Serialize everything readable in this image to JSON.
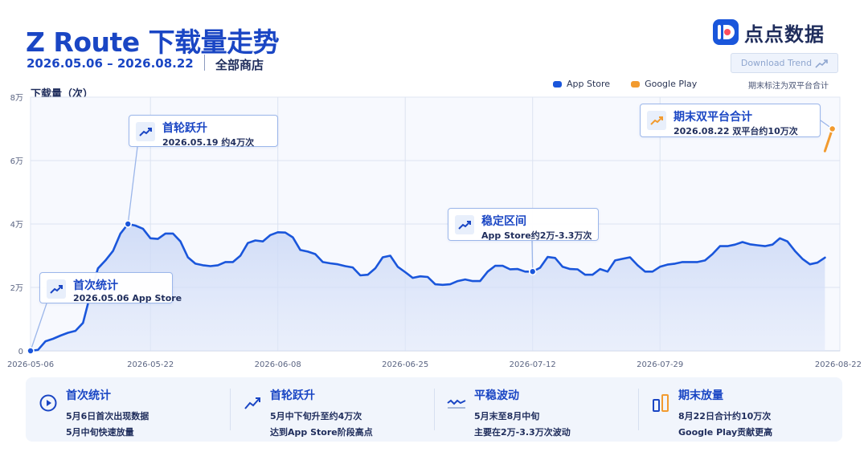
{
  "header": {
    "title": "Z Route 下载量走势",
    "date_range": "2026.05.06 – 2026.08.22",
    "store": "全部商店",
    "brand_name": "点点数据",
    "download_label": "Download Trend"
  },
  "legend": {
    "items": [
      {
        "label": "App Store",
        "color": "#1a56db"
      },
      {
        "label": "Google Play",
        "color": "#f29b2f"
      }
    ],
    "note": "期末标注为双平台合计"
  },
  "chart_data": {
    "type": "line",
    "title": "Z Route 下载量走势",
    "ylabel": "下载量（次）",
    "xlabel": "",
    "ylim": [
      0,
      80000
    ],
    "y_ticks": [
      {
        "value": 0,
        "label": "0"
      },
      {
        "value": 20000,
        "label": "2万"
      },
      {
        "value": 40000,
        "label": "4万"
      },
      {
        "value": 60000,
        "label": "6万"
      },
      {
        "value": 80000,
        "label": "8万"
      }
    ],
    "x_ticks": [
      "2026-05-06",
      "2026-05-22",
      "2026-06-08",
      "2026-06-25",
      "2026-07-12",
      "2026-07-29",
      "2026-08-22"
    ],
    "grid": true,
    "legend_position": "top-right",
    "series": [
      {
        "name": "App Store",
        "color": "#1a56db",
        "points": [
          [
            "2026-05-06",
            0
          ],
          [
            "2026-05-07",
            300
          ],
          [
            "2026-05-08",
            3000
          ],
          [
            "2026-05-09",
            3800
          ],
          [
            "2026-05-10",
            4800
          ],
          [
            "2026-05-11",
            5700
          ],
          [
            "2026-05-12",
            6300
          ],
          [
            "2026-05-13",
            8800
          ],
          [
            "2026-05-14",
            18000
          ],
          [
            "2026-05-15",
            26000
          ],
          [
            "2026-05-16",
            28500
          ],
          [
            "2026-05-17",
            31500
          ],
          [
            "2026-05-18",
            37000
          ],
          [
            "2026-05-19",
            40000
          ],
          [
            "2026-05-20",
            39500
          ],
          [
            "2026-05-21",
            38500
          ],
          [
            "2026-05-22",
            35500
          ],
          [
            "2026-05-23",
            35300
          ],
          [
            "2026-05-24",
            37000
          ],
          [
            "2026-05-25",
            37000
          ],
          [
            "2026-05-26",
            34500
          ],
          [
            "2026-05-27",
            29500
          ],
          [
            "2026-05-28",
            27500
          ],
          [
            "2026-05-29",
            27000
          ],
          [
            "2026-05-30",
            26700
          ],
          [
            "2026-05-31",
            27000
          ],
          [
            "2026-06-01",
            28000
          ],
          [
            "2026-06-02",
            28000
          ],
          [
            "2026-06-03",
            30000
          ],
          [
            "2026-06-04",
            34000
          ],
          [
            "2026-06-05",
            34800
          ],
          [
            "2026-06-06",
            34500
          ],
          [
            "2026-06-07",
            36500
          ],
          [
            "2026-06-08",
            37400
          ],
          [
            "2026-06-09",
            37300
          ],
          [
            "2026-06-10",
            35800
          ],
          [
            "2026-06-11",
            31800
          ],
          [
            "2026-06-12",
            31300
          ],
          [
            "2026-06-13",
            30500
          ],
          [
            "2026-06-14",
            28000
          ],
          [
            "2026-06-15",
            27600
          ],
          [
            "2026-06-16",
            27300
          ],
          [
            "2026-06-17",
            26700
          ],
          [
            "2026-06-18",
            26300
          ],
          [
            "2026-06-19",
            23800
          ],
          [
            "2026-06-20",
            24000
          ],
          [
            "2026-06-21",
            26000
          ],
          [
            "2026-06-22",
            29500
          ],
          [
            "2026-06-23",
            30000
          ],
          [
            "2026-06-24",
            26500
          ],
          [
            "2026-06-25",
            24800
          ],
          [
            "2026-06-26",
            23000
          ],
          [
            "2026-06-27",
            23500
          ],
          [
            "2026-06-28",
            23300
          ],
          [
            "2026-06-29",
            21000
          ],
          [
            "2026-06-30",
            20800
          ],
          [
            "2026-07-01",
            21000
          ],
          [
            "2026-07-02",
            22000
          ],
          [
            "2026-07-03",
            22500
          ],
          [
            "2026-07-04",
            22000
          ],
          [
            "2026-07-05",
            22000
          ],
          [
            "2026-07-06",
            25000
          ],
          [
            "2026-07-07",
            26800
          ],
          [
            "2026-07-08",
            26800
          ],
          [
            "2026-07-09",
            25700
          ],
          [
            "2026-07-10",
            25800
          ],
          [
            "2026-07-11",
            25000
          ],
          [
            "2026-07-12",
            25000
          ],
          [
            "2026-07-13",
            26200
          ],
          [
            "2026-07-14",
            29600
          ],
          [
            "2026-07-15",
            29300
          ],
          [
            "2026-07-16",
            26500
          ],
          [
            "2026-07-17",
            25800
          ],
          [
            "2026-07-18",
            25700
          ],
          [
            "2026-07-19",
            24000
          ],
          [
            "2026-07-20",
            24000
          ],
          [
            "2026-07-21",
            25800
          ],
          [
            "2026-07-22",
            25000
          ],
          [
            "2026-07-23",
            28500
          ],
          [
            "2026-07-24",
            29000
          ],
          [
            "2026-07-25",
            29500
          ],
          [
            "2026-07-26",
            27000
          ],
          [
            "2026-07-27",
            25000
          ],
          [
            "2026-07-28",
            25000
          ],
          [
            "2026-07-29",
            26500
          ],
          [
            "2026-07-30",
            27200
          ],
          [
            "2026-07-31",
            27500
          ],
          [
            "2026-08-01",
            28000
          ],
          [
            "2026-08-02",
            28000
          ],
          [
            "2026-08-03",
            28000
          ],
          [
            "2026-08-04",
            28500
          ],
          [
            "2026-08-05",
            30500
          ],
          [
            "2026-08-06",
            33000
          ],
          [
            "2026-08-07",
            33000
          ],
          [
            "2026-08-08",
            33500
          ],
          [
            "2026-08-09",
            34300
          ],
          [
            "2026-08-10",
            33600
          ],
          [
            "2026-08-11",
            33300
          ],
          [
            "2026-08-12",
            33000
          ],
          [
            "2026-08-13",
            33500
          ],
          [
            "2026-08-14",
            35500
          ],
          [
            "2026-08-15",
            34500
          ],
          [
            "2026-08-16",
            31500
          ],
          [
            "2026-08-17",
            29000
          ],
          [
            "2026-08-18",
            27300
          ],
          [
            "2026-08-19",
            27800
          ],
          [
            "2026-08-20",
            29400
          ]
        ]
      },
      {
        "name": "Google Play",
        "color": "#f29b2f",
        "points": [
          [
            "2026-08-20",
            63000
          ],
          [
            "2026-08-21",
            70000
          ]
        ]
      }
    ],
    "annotations": [
      {
        "date": "2026-05-06",
        "value": 0,
        "title": "首次统计",
        "subtitle": "2026.05.06  App Store"
      },
      {
        "date": "2026-05-19",
        "value": 40000,
        "title": "首轮跃升",
        "subtitle": "2026.05.19  约4万次"
      },
      {
        "date": "2026-07-12",
        "value": 25000,
        "title": "稳定区间",
        "subtitle": "App Store约2万-3.3万次"
      },
      {
        "date": "2026-08-21",
        "value": 70000,
        "title": "期末双平台合计",
        "subtitle": "2026.08.22  双平台约10万次"
      }
    ]
  },
  "summary": [
    {
      "icon": "play-circle-icon",
      "title": "首次统计",
      "line1": "5月6日首次出现数据",
      "line2": "5月中旬快速放量"
    },
    {
      "icon": "trend-up-icon",
      "title": "首轮跃升",
      "line1": "5月中下旬升至约4万次",
      "line2": "达到App Store阶段高点"
    },
    {
      "icon": "wave-icon",
      "title": "平稳波动",
      "line1": "5月末至8月中旬",
      "line2": "主要在2万-3.3万次波动"
    },
    {
      "icon": "bars-icon",
      "title": "期末放量",
      "line1": "8月22日合计约10万次",
      "line2": "Google Play贡献更高"
    }
  ]
}
